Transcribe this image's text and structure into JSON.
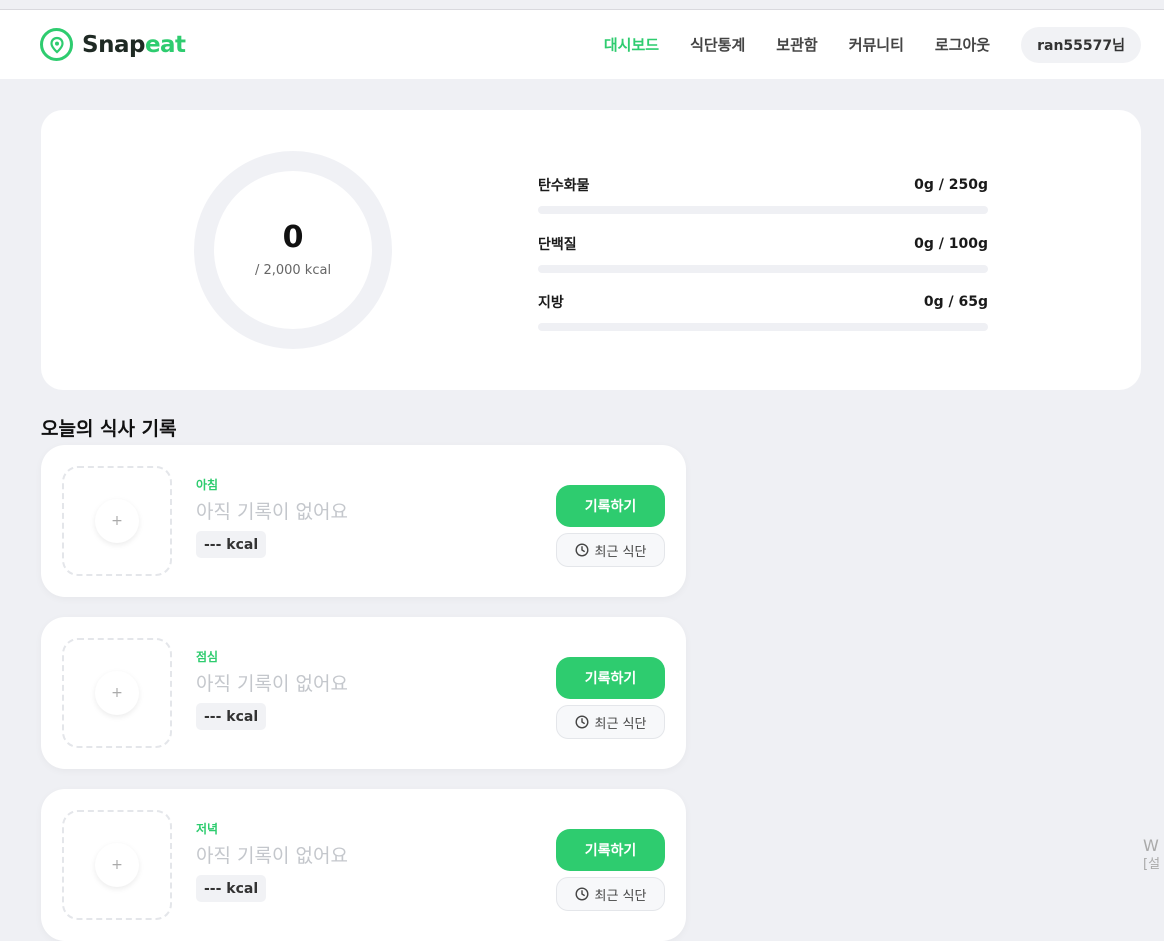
{
  "brand": {
    "part1": "Snap",
    "part2": "eat"
  },
  "nav": {
    "items": [
      {
        "label": "대시보드",
        "active": true
      },
      {
        "label": "식단통계",
        "active": false
      },
      {
        "label": "보관함",
        "active": false
      },
      {
        "label": "커뮤니티",
        "active": false
      },
      {
        "label": "로그아웃",
        "active": false
      }
    ],
    "user": "ran55577님"
  },
  "summary": {
    "calories": "0",
    "goal": "/ 2,000 kcal",
    "calorie_progress": 0,
    "macros": [
      {
        "name": "탄수화물",
        "value": "0g / 250g",
        "progress": 0
      },
      {
        "name": "단백질",
        "value": "0g / 100g",
        "progress": 0
      },
      {
        "name": "지방",
        "value": "0g / 65g",
        "progress": 0
      }
    ]
  },
  "meals_title": "오늘의 식사 기록",
  "meals": [
    {
      "type": "아침",
      "empty_text": "아직 기록이 없어요",
      "kcal": "--- kcal",
      "record_label": "기록하기",
      "recent_label": "최근 식단"
    },
    {
      "type": "점심",
      "empty_text": "아직 기록이 없어요",
      "kcal": "--- kcal",
      "record_label": "기록하기",
      "recent_label": "최근 식단"
    },
    {
      "type": "저녁",
      "empty_text": "아직 기록이 없어요",
      "kcal": "--- kcal",
      "record_label": "기록하기",
      "recent_label": "최근 식단"
    }
  ],
  "watermark": {
    "line1": "W",
    "line2": "[설"
  },
  "colors": {
    "accent": "#2ecc6f",
    "background": "#eff0f4",
    "ring_track": "#f0f1f5"
  }
}
